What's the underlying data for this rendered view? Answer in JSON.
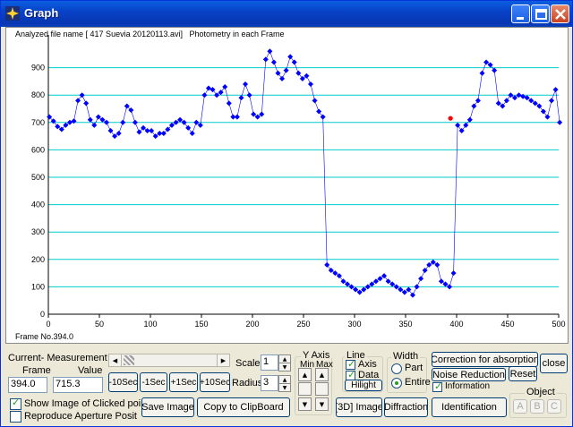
{
  "window": {
    "title": "Graph"
  },
  "plot": {
    "header": "Analyzed file name [ 417 Suevia 20120113.avi]   Photometry in each Frame",
    "frame_label": "Frame No.394.0"
  },
  "chart_data": {
    "type": "scatter",
    "title": "",
    "xlabel": "",
    "ylabel": "",
    "xlim": [
      0,
      500
    ],
    "ylim": [
      0,
      1000
    ],
    "x_ticks": [
      0,
      50,
      100,
      150,
      200,
      250,
      300,
      350,
      400,
      450,
      500
    ],
    "y_ticks": [
      0,
      100,
      200,
      300,
      400,
      500,
      600,
      700,
      800,
      900
    ],
    "grid": "horizontal",
    "colors": {
      "series": "#0000ff",
      "highlight": "#ff0000",
      "grid": "#00cccc"
    },
    "highlight_point": {
      "x": 394,
      "y": 715
    },
    "series": [
      {
        "x": [
          1,
          5,
          9,
          13,
          17,
          21,
          25,
          29,
          33,
          37,
          41,
          45,
          49,
          53,
          57,
          61,
          65,
          69,
          73,
          77,
          81,
          85,
          89,
          93,
          97,
          101,
          105,
          109,
          113,
          117,
          121,
          125,
          129,
          133,
          137,
          141,
          145,
          149,
          153,
          157,
          161,
          165,
          169,
          173,
          177,
          181,
          185,
          189,
          193,
          197,
          201,
          205,
          209,
          213,
          217,
          221,
          225,
          229,
          233,
          237,
          241,
          245,
          249,
          253,
          257,
          261,
          265,
          269,
          273,
          277,
          281,
          285,
          289,
          293,
          297,
          301,
          305,
          309,
          313,
          317,
          321,
          325,
          329,
          333,
          337,
          341,
          345,
          349,
          353,
          357,
          361,
          365,
          369,
          373,
          377,
          381,
          385,
          389,
          393,
          397,
          401,
          405,
          409,
          413,
          417,
          421,
          425,
          429,
          433,
          437,
          441,
          445,
          449,
          453,
          457,
          461,
          465,
          469,
          473,
          477,
          481,
          485,
          489,
          493,
          497,
          501
        ],
        "y": [
          720,
          705,
          685,
          675,
          690,
          700,
          705,
          780,
          800,
          770,
          710,
          690,
          720,
          710,
          700,
          670,
          650,
          660,
          700,
          760,
          745,
          700,
          665,
          680,
          670,
          670,
          650,
          660,
          660,
          675,
          690,
          700,
          710,
          700,
          680,
          660,
          700,
          690,
          800,
          825,
          820,
          800,
          810,
          830,
          770,
          720,
          720,
          790,
          840,
          800,
          730,
          720,
          730,
          930,
          960,
          920,
          880,
          860,
          890,
          940,
          920,
          880,
          860,
          870,
          840,
          780,
          740,
          720,
          180,
          160,
          150,
          140,
          120,
          110,
          100,
          90,
          80,
          90,
          100,
          110,
          120,
          130,
          140,
          120,
          110,
          100,
          90,
          80,
          90,
          70,
          100,
          130,
          160,
          180,
          190,
          180,
          120,
          110,
          100,
          150,
          690,
          670,
          690,
          710,
          760,
          780,
          880,
          920,
          910,
          890,
          770,
          760,
          780,
          800,
          790,
          800,
          795,
          790,
          780,
          770,
          760,
          740,
          720,
          780,
          820,
          700
        ]
      }
    ]
  },
  "controls": {
    "current_measurement_label": "Current- Measurement",
    "frame_label": "Frame",
    "value_label": "Value",
    "frame_value": "394.0",
    "value_value": "715.3",
    "minus10": "-10Sec",
    "minus1": "-1Sec",
    "plus1": "+1Sec",
    "plus10": "+10Sec",
    "scale_label": "Scale",
    "scale_value": "1",
    "radius_label": "Radius",
    "radius_value": "3",
    "show_image_label": "Show Image of Clicked poi",
    "reproduce_label": "Reproduce Aperture Posit",
    "save_image": "Save Image",
    "copy_clipboard": "Copy to ClipBoard",
    "yaxis_group": "Y Axis",
    "min_label": "Min",
    "max_label": "Max",
    "line_group": "Line",
    "axis_label": "Axis",
    "data_label": "Data",
    "hilight": "Hilight",
    "width_group": "Width",
    "part_label": "Part",
    "entire_label": "Entire",
    "image3d": "[3D] Image",
    "diffraction": "Diffraction",
    "correction": "Correction for absorption",
    "noise_reduction": "Noise Reduction",
    "reset": "Reset",
    "close": "close",
    "information": "Information",
    "identification": "Identification",
    "object_group": "Object",
    "obj_a": "A",
    "obj_b": "B",
    "obj_c": "C"
  }
}
